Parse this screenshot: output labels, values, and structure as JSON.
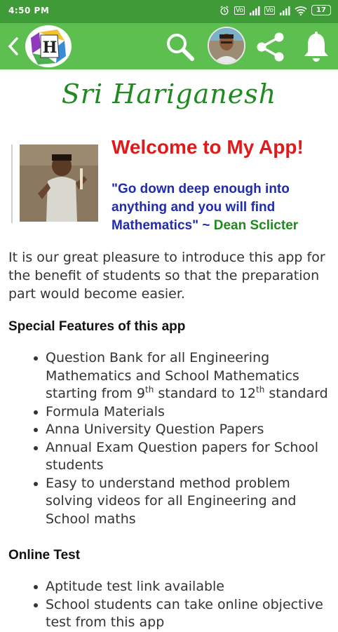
{
  "status": {
    "time": "4:50 PM",
    "battery": "17",
    "net1": "Vo",
    "net2": "Vo"
  },
  "header": {
    "back_label": "back"
  },
  "brand": {
    "title": "Sri Hariganesh"
  },
  "welcome": {
    "title": "Welcome to My App!",
    "quote": "\"Go down deep enough into anything and you will find Mathematics\"",
    "separator": " ~ ",
    "author": "Dean Sclicter"
  },
  "intro": "It is our great pleasure to introduce this app for the benefit of students so that the preparation part would become easier.",
  "features": {
    "heading": "Special Features of this app",
    "first": {
      "a": "Question Bank for all Engineering Mathematics and School Mathematics starting from 9",
      "sup1": "th",
      "b": " standard to 12",
      "sup2": "th",
      "c": " standard"
    },
    "items": [
      "Formula Materials",
      "Anna University Question Papers",
      "Annual Exam Question papers for School students",
      "Easy to understand method problem solving videos for all Engineering and School maths"
    ]
  },
  "online": {
    "heading": "Online Test",
    "items": [
      "Aptitude test link available",
      "School students can take online objective test from this app"
    ]
  },
  "colors": {
    "status_bar": "#3f9b37",
    "app_bar": "#5cbf4f",
    "brand": "#1f8a1f",
    "welcome": "#e01a1a",
    "quote": "#1f2bb0",
    "author": "#1e8a1e"
  },
  "icons": [
    "back-arrow-icon",
    "app-logo",
    "search-icon",
    "profile-avatar",
    "share-icon",
    "bell-icon"
  ]
}
